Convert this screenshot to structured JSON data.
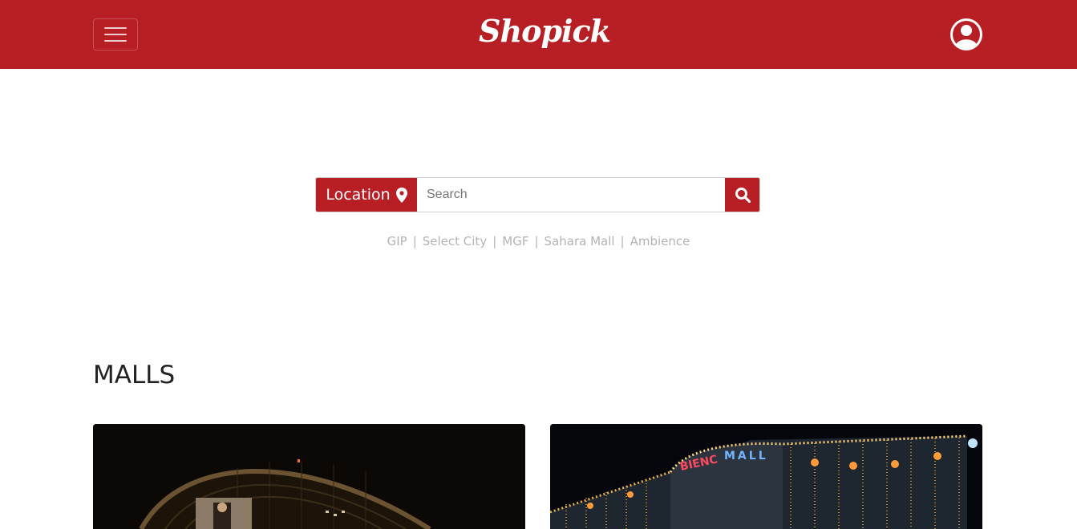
{
  "navbar": {
    "brand": "Shopick",
    "menu_icon": "hamburger-icon",
    "user_icon": "user-circle-icon",
    "background_color": "#b71f25"
  },
  "search": {
    "location_label": "Location",
    "location_icon": "map-marker-icon",
    "placeholder": "Search",
    "value": "",
    "search_icon": "search-icon"
  },
  "quick_links": [
    "GIP",
    "Select City",
    "MGF",
    "Sahara Mall",
    "Ambience"
  ],
  "malls_section": {
    "title": "MALLS"
  },
  "mall_cards": [
    {
      "image": "mall-photo-dome-night"
    },
    {
      "image": "mall-photo-lights-night",
      "sign_left": "BIENC",
      "sign_right": "MALL"
    }
  ]
}
